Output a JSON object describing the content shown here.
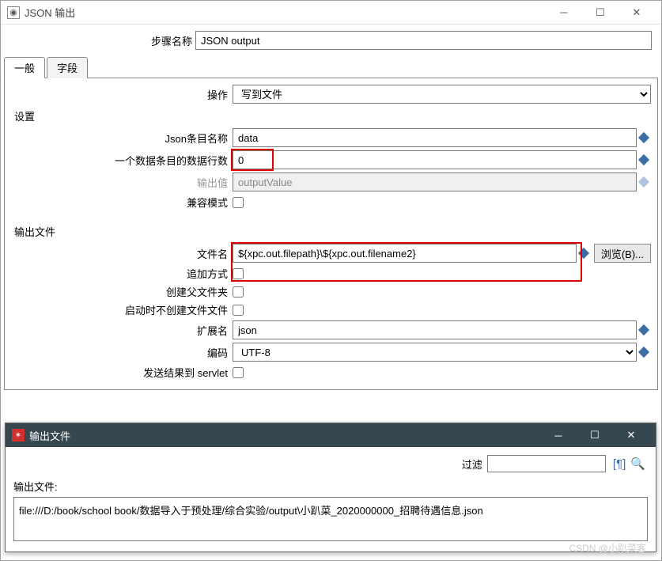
{
  "window": {
    "title": "JSON 输出",
    "step_label": "步骤名称",
    "step_value": "JSON output"
  },
  "tabs": {
    "general": "一般",
    "fields": "字段"
  },
  "operation": {
    "label": "操作",
    "value": "写到文件"
  },
  "settings": {
    "heading": "设置",
    "json_entry_label": "Json条目名称",
    "json_entry_value": "data",
    "rows_label": "一个数据条目的数据行数",
    "rows_value": "0",
    "output_value_label": "输出值",
    "output_value_value": "outputValue",
    "compat_label": "兼容模式"
  },
  "output_file": {
    "heading": "输出文件",
    "filename_label": "文件名",
    "filename_value": "${xpc.out.filepath}\\${xpc.out.filename2}",
    "browse_label": "浏览(B)...",
    "append_label": "追加方式",
    "create_parent_label": "创建父文件夹",
    "no_create_start_label": "启动时不创建文件文件",
    "ext_label": "扩展名",
    "ext_value": "json",
    "encoding_label": "编码",
    "encoding_value": "UTF-8",
    "servlet_label": "发送结果到 servlet"
  },
  "sub_window": {
    "title": "输出文件",
    "filter_label": "过滤",
    "output_label": "输出文件:",
    "output_value": "file:///D:/book/school book/数据导入于预处理/综合实验/output\\小趴菜_2020000000_招聘待遇信息.json"
  },
  "watermark": "CSDN @小趴菜客"
}
